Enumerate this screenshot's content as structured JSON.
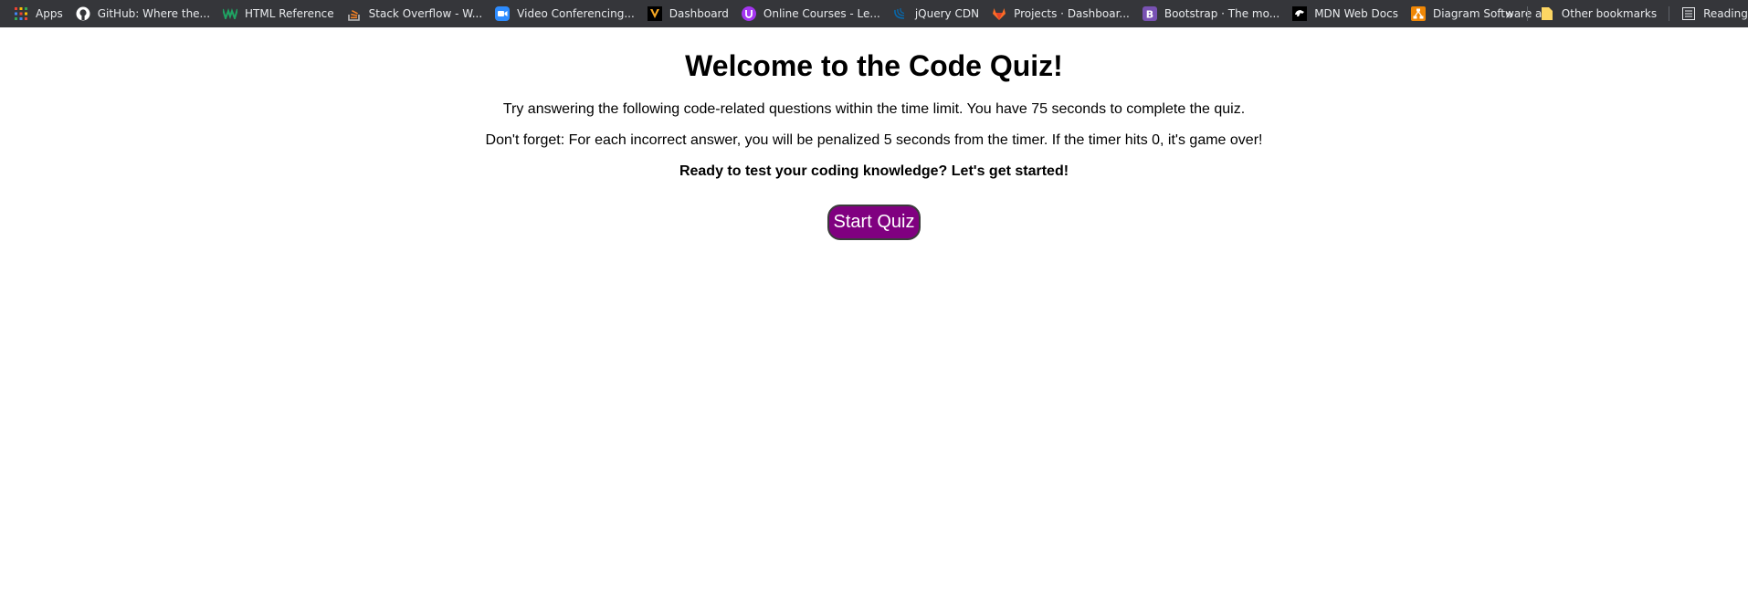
{
  "bookmarks": [
    {
      "label": "Apps",
      "icon": "apps-grid-icon",
      "color": "#ea4335"
    },
    {
      "label": "GitHub: Where the...",
      "icon": "github-icon",
      "color": "#ffffff"
    },
    {
      "label": "HTML Reference",
      "icon": "html-reference-icon",
      "color": "#1fa463"
    },
    {
      "label": "Stack Overflow - W...",
      "icon": "stack-overflow-icon",
      "color": "#f48024"
    },
    {
      "label": "Video Conferencing...",
      "icon": "zoom-icon",
      "color": "#2d8cff"
    },
    {
      "label": "Dashboard",
      "icon": "v-logo-icon",
      "color": "#f5a623"
    },
    {
      "label": "Online Courses - Le...",
      "icon": "udemy-icon",
      "color": "#a435f0"
    },
    {
      "label": "jQuery CDN",
      "icon": "jquery-icon",
      "color": "#0769ad"
    },
    {
      "label": "Projects · Dashboar...",
      "icon": "gitlab-icon",
      "color": "#fc6d26"
    },
    {
      "label": "Bootstrap · The mo...",
      "icon": "bootstrap-icon",
      "color": "#7952b3"
    },
    {
      "label": "MDN Web Docs",
      "icon": "mdn-icon",
      "color": "#ffffff"
    },
    {
      "label": "Diagram Software a...",
      "icon": "diagram-icon",
      "color": "#f08705"
    }
  ],
  "other_bookmarks": "Other bookmarks",
  "reading_list": "Reading list",
  "chevron": "»",
  "quiz": {
    "title": "Welcome to the Code Quiz!",
    "intro": "Try answering the following code-related questions within the time limit. You have 75 seconds to complete the quiz.",
    "warning": "Don't forget: For each incorrect answer, you will be penalized 5 seconds from the timer. If the timer hits 0, it's game over!",
    "ready": "Ready to test your coding knowledge? Let's get started!",
    "start_label": "Start Quiz"
  },
  "colors": {
    "button": "#800080",
    "bookmarks_bar": "#35363a"
  }
}
